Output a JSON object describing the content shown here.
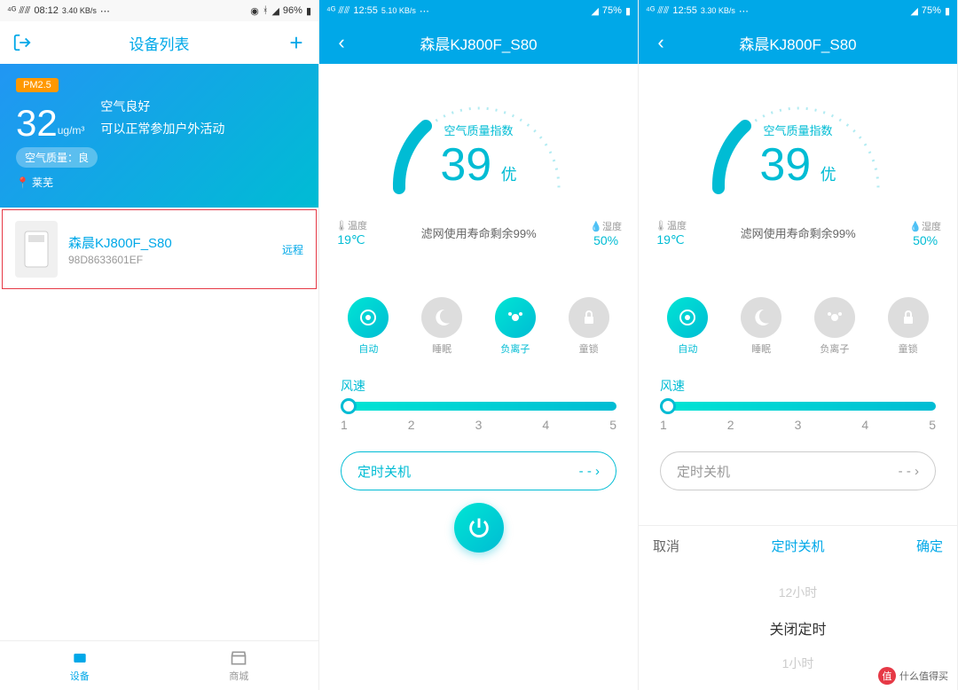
{
  "panel1": {
    "status": {
      "time": "08:12",
      "net": "3.40 KB/s",
      "battery": "96%",
      "signal": "4G"
    },
    "nav": {
      "title": "设备列表"
    },
    "card": {
      "pm_label": "PM2.5",
      "value": "32",
      "unit": "ug/m³",
      "quality_text": "空气良好",
      "advice": "可以正常参加户外活动",
      "quality_badge": "空气质量：良",
      "location": "莱芜"
    },
    "device": {
      "name": "森晨KJ800F_S80",
      "mac": "98D8633601EF",
      "tag": "远程"
    },
    "bottom_nav": [
      "设备",
      "商城"
    ]
  },
  "panel2": {
    "status": {
      "time": "12:55",
      "net": "5.10 KB/s",
      "battery": "75%"
    },
    "nav": {
      "title": "森晨KJ800F_S80"
    },
    "gauge": {
      "label": "空气质量指数",
      "value": "39",
      "grade": "优"
    },
    "env": {
      "temp_label": "温度",
      "temp": "19℃",
      "filter": "滤网使用寿命剩余99%",
      "hum_label": "湿度",
      "hum": "50%"
    },
    "modes": [
      {
        "label": "自动",
        "active": true
      },
      {
        "label": "睡眠",
        "active": false
      },
      {
        "label": "负离子",
        "active": true
      },
      {
        "label": "童锁",
        "active": false
      }
    ],
    "fan": {
      "label": "风速",
      "marks": [
        "1",
        "2",
        "3",
        "4",
        "5"
      ]
    },
    "timer": {
      "label": "定时关机",
      "value": "- -"
    }
  },
  "panel3": {
    "status": {
      "time": "12:55",
      "net": "3.30 KB/s",
      "battery": "75%"
    },
    "nav": {
      "title": "森晨KJ800F_S80"
    },
    "gauge": {
      "label": "空气质量指数",
      "value": "39",
      "grade": "优"
    },
    "env": {
      "temp_label": "温度",
      "temp": "19℃",
      "filter": "滤网使用寿命剩余99%",
      "hum_label": "湿度",
      "hum": "50%"
    },
    "modes": [
      {
        "label": "自动",
        "active": true
      },
      {
        "label": "睡眠",
        "active": false
      },
      {
        "label": "负离子",
        "active": false
      },
      {
        "label": "童锁",
        "active": false
      }
    ],
    "fan": {
      "label": "风速",
      "marks": [
        "1",
        "2",
        "3",
        "4",
        "5"
      ]
    },
    "timer": {
      "label": "定时关机",
      "value": "- -"
    },
    "picker": {
      "cancel": "取消",
      "title": "定时关机",
      "confirm": "确定",
      "items": [
        "12小时",
        "关闭定时",
        "1小时"
      ]
    }
  },
  "watermark": "什么值得买"
}
